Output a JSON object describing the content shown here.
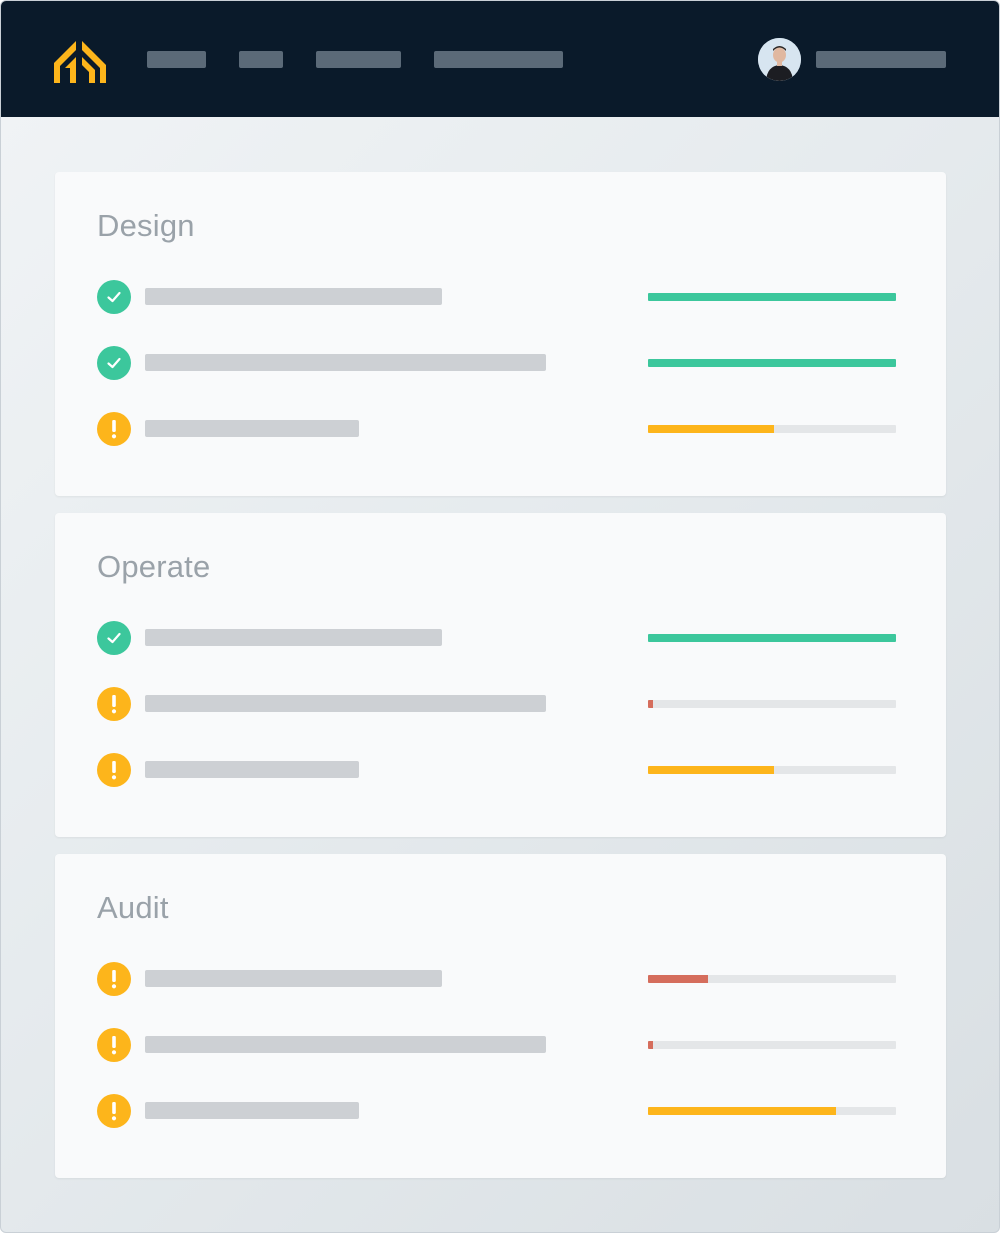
{
  "header": {
    "logo_icon": "chevron-up-arrows-logo",
    "logo_color": "#fdb51b",
    "nav_items": [
      "",
      "",
      "",
      ""
    ],
    "user_name": "",
    "avatar_icon": "user-avatar"
  },
  "colors": {
    "ok": "#3cc79c",
    "warn": "#fdb51b",
    "critical": "#d56d5c",
    "track": "#e4e6e8",
    "placeholder": "#cdd0d4"
  },
  "sections": [
    {
      "title": "Design",
      "items": [
        {
          "status": "ok",
          "status_icon": "check-icon",
          "progress": 1.0,
          "bar_color": "ok"
        },
        {
          "status": "ok",
          "status_icon": "check-icon",
          "progress": 1.0,
          "bar_color": "ok"
        },
        {
          "status": "warn",
          "status_icon": "exclamation-icon",
          "progress": 0.51,
          "bar_color": "warn"
        }
      ]
    },
    {
      "title": "Operate",
      "items": [
        {
          "status": "ok",
          "status_icon": "check-icon",
          "progress": 1.0,
          "bar_color": "ok"
        },
        {
          "status": "warn",
          "status_icon": "exclamation-icon",
          "progress": 0.02,
          "bar_color": "critical"
        },
        {
          "status": "warn",
          "status_icon": "exclamation-icon",
          "progress": 0.51,
          "bar_color": "warn"
        }
      ]
    },
    {
      "title": "Audit",
      "items": [
        {
          "status": "warn",
          "status_icon": "exclamation-icon",
          "progress": 0.24,
          "bar_color": "critical"
        },
        {
          "status": "warn",
          "status_icon": "exclamation-icon",
          "progress": 0.02,
          "bar_color": "critical"
        },
        {
          "status": "warn",
          "status_icon": "exclamation-icon",
          "progress": 0.76,
          "bar_color": "warn"
        }
      ]
    }
  ]
}
